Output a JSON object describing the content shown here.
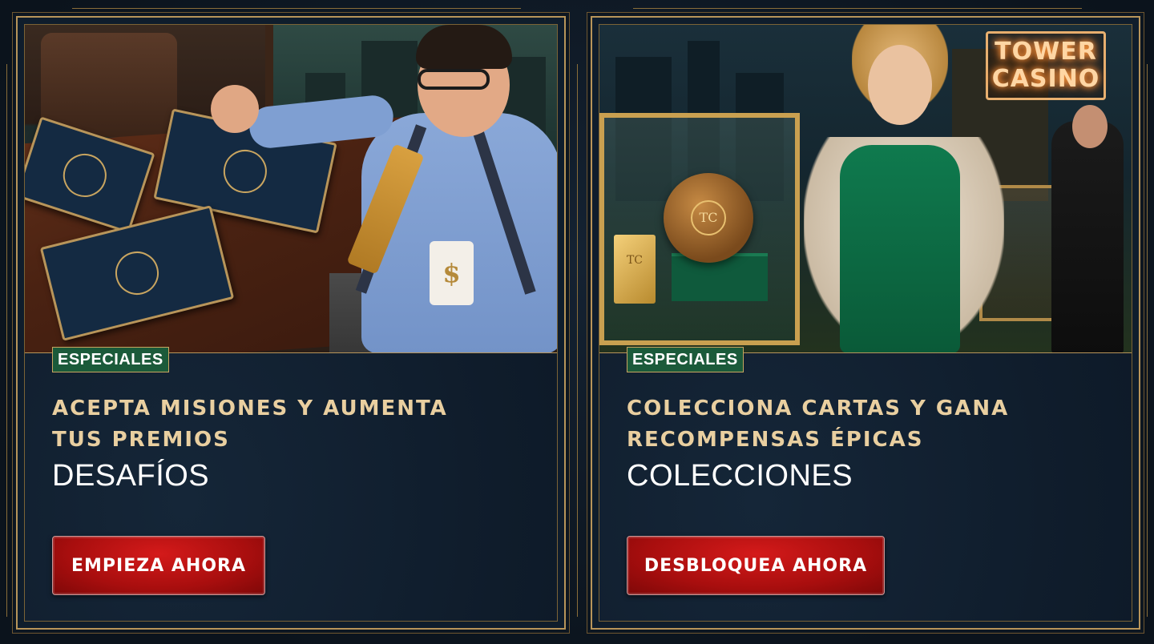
{
  "cards": [
    {
      "badge": "ESPECIALES",
      "subtitle": "ACEPTA MISIONES Y AUMENTA TUS PREMIOS",
      "title": "DESAFÍOS",
      "button": "EMPIEZA AHORA",
      "art": {
        "mug_symbol": "$"
      }
    },
    {
      "badge": "ESPECIALES",
      "subtitle": "COLECCIONA CARTAS Y GANA RECOMPENSAS ÉPICAS",
      "title": "COLECCIONES",
      "button": "DESBLOQUEA AHORA",
      "art": {
        "sign_line1": "TOWER",
        "sign_line2": "CASINO",
        "emblem": "TC"
      }
    }
  ],
  "colors": {
    "gold": "#b8955a",
    "badge_green": "#1b5a3a",
    "button_red": "#b01212",
    "panel_navy": "#0f1d2c"
  }
}
